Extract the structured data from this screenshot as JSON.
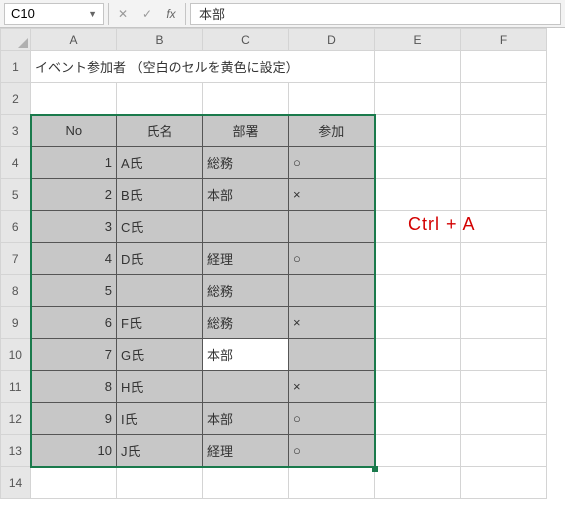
{
  "formula_bar": {
    "name_box": "C10",
    "cancel_glyph": "✕",
    "confirm_glyph": "✓",
    "fx_glyph": "fx",
    "formula_value": "本部"
  },
  "columns": [
    "A",
    "B",
    "C",
    "D",
    "E",
    "F"
  ],
  "row_headers": [
    "1",
    "2",
    "3",
    "4",
    "5",
    "6",
    "7",
    "8",
    "9",
    "10",
    "11",
    "12",
    "13",
    "14"
  ],
  "title": "イベント参加者 （空白のセルを黄色に設定）",
  "table": {
    "header": {
      "no": "No",
      "name": "氏名",
      "dept": "部署",
      "attend": "参加"
    },
    "rows": [
      {
        "no": "1",
        "name": "A氏",
        "dept": "総務",
        "attend": "○"
      },
      {
        "no": "2",
        "name": "B氏",
        "dept": "本部",
        "attend": "×"
      },
      {
        "no": "3",
        "name": "C氏",
        "dept": "",
        "attend": ""
      },
      {
        "no": "4",
        "name": "D氏",
        "dept": "経理",
        "attend": "○"
      },
      {
        "no": "5",
        "name": "",
        "dept": "総務",
        "attend": ""
      },
      {
        "no": "6",
        "name": "F氏",
        "dept": "総務",
        "attend": "×"
      },
      {
        "no": "7",
        "name": "G氏",
        "dept": "本部",
        "attend": ""
      },
      {
        "no": "8",
        "name": "H氏",
        "dept": "",
        "attend": "×"
      },
      {
        "no": "9",
        "name": "I氏",
        "dept": "本部",
        "attend": "○"
      },
      {
        "no": "10",
        "name": "J氏",
        "dept": "経理",
        "attend": "○"
      }
    ]
  },
  "annotation": "Ctrl +  A"
}
